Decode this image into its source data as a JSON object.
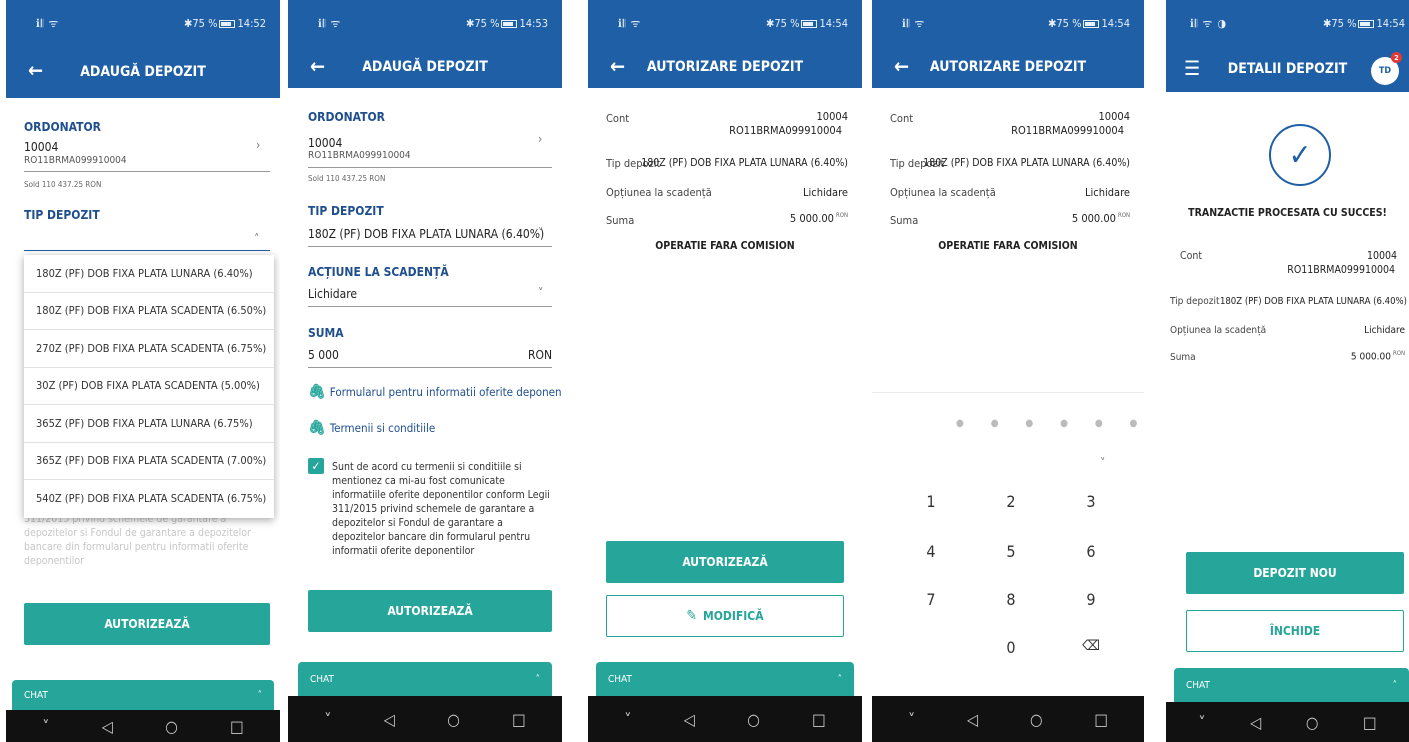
{
  "screens": [
    {
      "status": {
        "signal": "ℹ𝄃 ᯤ",
        "battery": "75 %",
        "time": "14:52"
      },
      "title": "ADAUGĂ DEPOZIT",
      "ordonator_label": "ORDONATOR",
      "account": "10004",
      "iban": "RO11BRMA099910004",
      "sold": "Sold 110 437.25 RON",
      "tip_label": "TIP DEPOZIT",
      "options": [
        "180Z (PF) DOB FIXA PLATA LUNARA (6.40%)",
        "180Z (PF) DOB FIXA PLATA SCADENTA (6.50%)",
        "270Z (PF) DOB FIXA PLATA SCADENTA (6.75%)",
        "30Z (PF) DOB FIXA PLATA SCADENTA (5.00%)",
        "365Z (PF) DOB FIXA PLATA LUNARA (6.75%)",
        "365Z (PF) DOB FIXA PLATA SCADENTA (7.00%)",
        "540Z (PF) DOB FIXA PLATA SCADENTA (6.75%)"
      ],
      "faded_terms": "informatiile oferite deponentilor conform Legii 311/2015 privind schemele de garantare a depozitelor si Fondul de garantare a depozitelor bancare din formularul pentru informatii oferite deponentilor",
      "authorize": "AUTORIZEAZĂ",
      "chat": "CHAT"
    },
    {
      "status": {
        "signal": "ℹ𝄃 ᯤ",
        "battery": "75 %",
        "time": "14:53"
      },
      "title": "ADAUGĂ DEPOZIT",
      "ordonator_label": "ORDONATOR",
      "account": "10004",
      "iban": "RO11BRMA099910004",
      "sold": "Sold 110 437.25 RON",
      "tip_label": "TIP DEPOZIT",
      "tip_value": "180Z (PF) DOB FIXA PLATA LUNARA (6.40%)",
      "actiune_label": "ACȚIUNE LA SCADENȚĂ",
      "actiune_value": "Lichidare",
      "suma_label": "SUMA",
      "suma_value": "5 000",
      "currency": "RON",
      "link1": "Formularul pentru informatii oferite deponentilor",
      "link2": "Termenii si conditiile",
      "terms": "Sunt de acord cu termenii si conditiile si mentionez ca mi-au fost comunicate informatiile oferite deponentilor conform Legii 311/2015 privind schemele de garantare a depozitelor si Fondul de garantare a depozitelor bancare din formularul pentru informatii oferite deponentilor",
      "authorize": "AUTORIZEAZĂ",
      "chat": "CHAT"
    },
    {
      "status": {
        "signal": "ℹ𝄃 ᯤ",
        "battery": "75 %",
        "time": "14:54"
      },
      "title": "AUTORIZARE DEPOZIT",
      "cont_label": "Cont",
      "cont_value1": "10004",
      "cont_value2": "RO11BRMA099910004",
      "tip_label": "Tip depozit",
      "tip_value": "180Z (PF) DOB FIXA PLATA LUNARA (6.40%)",
      "optiune_label": "Opțiunea la scadență",
      "optiune_value": "Lichidare",
      "suma_label": "Suma",
      "suma_value": "5 000.00",
      "currency_sup": "RON",
      "fee_note": "OPERATIE FARA COMISION",
      "authorize": "AUTORIZEAZĂ",
      "modify": "MODIFICĂ",
      "chat": "CHAT"
    },
    {
      "status": {
        "signal": "ℹ𝄃 ᯤ",
        "battery": "75 %",
        "time": "14:54"
      },
      "title": "AUTORIZARE DEPOZIT",
      "cont_label": "Cont",
      "cont_value1": "10004",
      "cont_value2": "RO11BRMA099910004",
      "tip_label": "Tip depozit",
      "tip_value": "180Z (PF) DOB FIXA PLATA LUNARA (6.40%)",
      "optiune_label": "Opțiunea la scadență",
      "optiune_value": "Lichidare",
      "suma_label": "Suma",
      "suma_value": "5 000.00",
      "currency_sup": "RON",
      "fee_note": "OPERATIE FARA COMISION",
      "pin_dots": "● ● ● ● ● ●",
      "keys": [
        "1",
        "2",
        "3",
        "4",
        "5",
        "6",
        "7",
        "8",
        "9",
        "0"
      ]
    },
    {
      "status": {
        "signal": "ℹ𝄃 ᯤ ◑",
        "battery": "75 %",
        "time": "14:54"
      },
      "title": "DETALII DEPOZIT",
      "avatar": "TD",
      "badge": "2",
      "success": "TRANZACTIE PROCESATA CU SUCCES!",
      "cont_label": "Cont",
      "cont_value1": "10004",
      "cont_value2": "RO11BRMA099910004",
      "tip_label": "Tip depozit",
      "tip_value": "180Z (PF) DOB FIXA PLATA LUNARA (6.40%)",
      "optiune_label": "Opțiunea la scadență",
      "optiune_value": "Lichidare",
      "suma_label": "Suma",
      "suma_value": "5 000.00",
      "currency_sup": "RON",
      "new_deposit": "DEPOZIT NOU",
      "close": "ÎNCHIDE",
      "chat": "CHAT"
    }
  ],
  "colors": {
    "header": "#1f5fa6",
    "accent": "#26a69a",
    "label": "#1f4f8f"
  },
  "icons": [
    "back-arrow-icon",
    "menu-icon",
    "chevron-right-icon",
    "chevron-down-icon",
    "chevron-up-icon",
    "paperclip-icon",
    "pencil-icon",
    "check-icon",
    "backspace-icon",
    "nav-back-icon",
    "nav-home-icon",
    "nav-recent-icon"
  ]
}
